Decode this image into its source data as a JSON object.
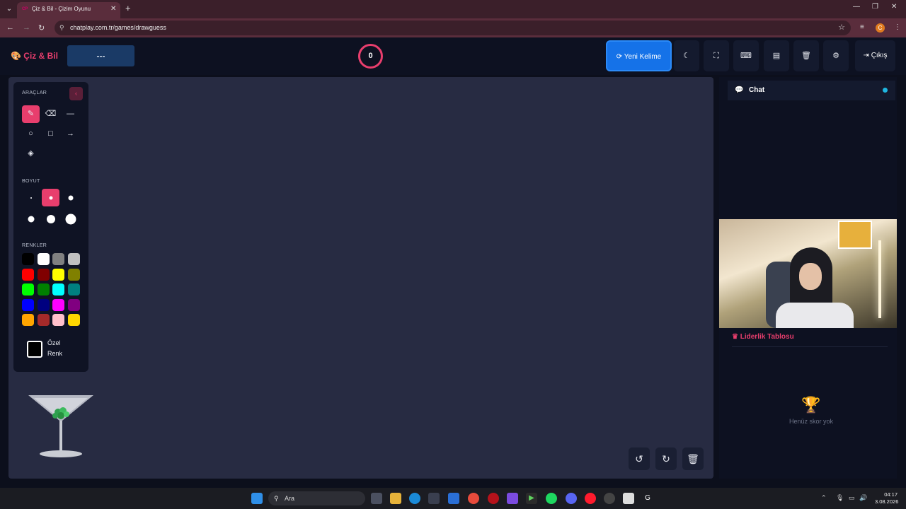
{
  "browser": {
    "tab_title": "Çiz & Bil - Çizim Oyunu",
    "tab_favicon": "CP",
    "url": "chatplay.com.tr/games/drawguess",
    "profile_initial": "C"
  },
  "header": {
    "logo": "Çiz & Bil",
    "word_placeholder": "---",
    "timer": "0",
    "new_word_label": "Yeni Kelime",
    "exit_label": "Çıkış"
  },
  "tools": {
    "tools_heading": "ARAÇLAR",
    "size_heading": "BOYUT",
    "colors_heading": "RENKLER",
    "custom_color_label": "Özel Renk",
    "palette": [
      "#000000",
      "#ffffff",
      "#808080",
      "#c0c0c0",
      "#ff0000",
      "#800000",
      "#ffff00",
      "#808000",
      "#00ff00",
      "#008000",
      "#00ffff",
      "#008080",
      "#0000ff",
      "#000080",
      "#ff00ff",
      "#800080",
      "#ffa500",
      "#a52a2a",
      "#ffc0cb",
      "#ffd700"
    ]
  },
  "chat": {
    "title": "Chat"
  },
  "leaderboard": {
    "title": "Liderlik Tablosu",
    "empty": "Henüz skor yok"
  },
  "taskbar": {
    "search_placeholder": "Ara",
    "time": "04:17",
    "date": "3.08.2026"
  },
  "colors": {
    "accent": "#e83e6d",
    "primary": "#1572e8",
    "canvas": "#272b42"
  }
}
